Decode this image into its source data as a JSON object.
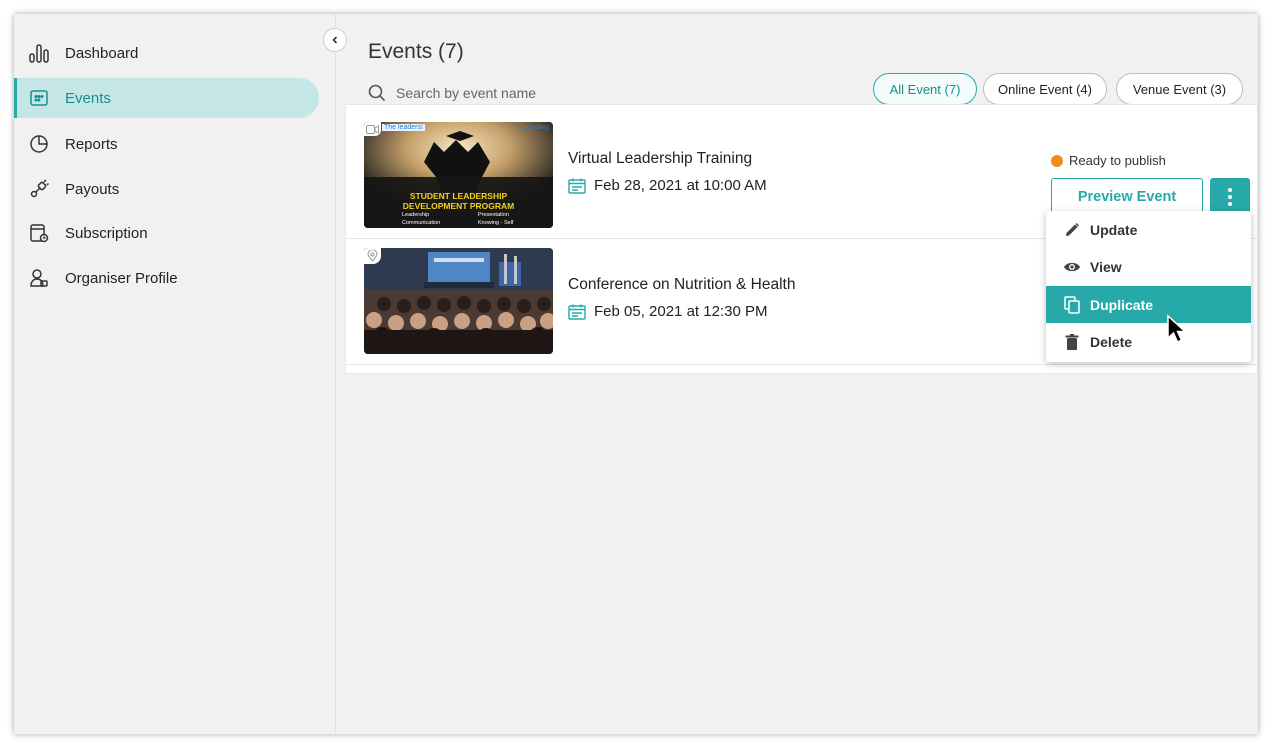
{
  "sidebar": {
    "items": [
      {
        "label": "Dashboard",
        "icon": "bar-chart-icon"
      },
      {
        "label": "Events",
        "icon": "calendar-grid-icon",
        "active": true
      },
      {
        "label": "Reports",
        "icon": "pie-chart-icon"
      },
      {
        "label": "Payouts",
        "icon": "payout-plug-icon"
      },
      {
        "label": "Subscription",
        "icon": "subscription-icon"
      },
      {
        "label": "Organiser Profile",
        "icon": "profile-icon"
      }
    ]
  },
  "header": {
    "title": "Events (7)",
    "search_placeholder": "Search by event name"
  },
  "tabs": [
    {
      "label": "All Event (7)",
      "active": true
    },
    {
      "label": "Online Event (4)"
    },
    {
      "label": "Venue Event (3)"
    }
  ],
  "events": [
    {
      "title": "Virtual Leadership Training",
      "date": "Feb 28, 2021 at 10:00 AM",
      "type_icon": "video-icon",
      "status": "Ready to publish",
      "status_color": "#f08c1a",
      "preview_label": "Preview Event",
      "thumbnail": {
        "top_left_text": "The leaders!",
        "logo_text": "Consulting",
        "heading_line1": "STUDENT LEADERSHIP",
        "heading_line2": "DEVELOPMENT PROGRAM",
        "topics": [
          "Leadership",
          "Presentation",
          "Communication",
          "Knowing - Self"
        ]
      }
    },
    {
      "title": "Conference on Nutrition & Health",
      "date": "Feb 05, 2021 at 12:30 PM",
      "type_icon": "location-pin-icon"
    }
  ],
  "menu": {
    "items": [
      {
        "label": "Update",
        "icon": "pencil-icon"
      },
      {
        "label": "View",
        "icon": "eye-icon"
      },
      {
        "label": "Duplicate",
        "icon": "copy-icon",
        "hover": true
      },
      {
        "label": "Delete",
        "icon": "trash-icon"
      }
    ]
  },
  "colors": {
    "accent": "#27a9a9",
    "active_nav_bg": "#c5e6e6",
    "status_dot": "#f08c1a"
  }
}
